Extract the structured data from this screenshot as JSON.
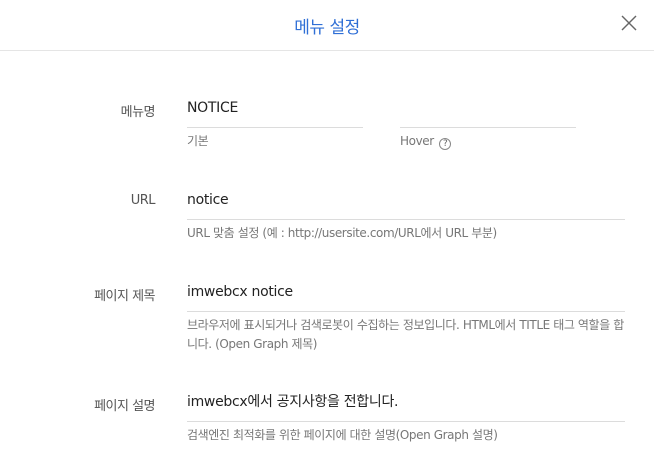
{
  "header": {
    "title": "메뉴 설정",
    "close_icon": "close-icon"
  },
  "fields": {
    "menu_name": {
      "label": "메뉴명",
      "value": "NOTICE",
      "default_label": "기본",
      "hover_label": "Hover",
      "hover_value": "",
      "help_icon": "question-circle-icon",
      "help_glyph": "?"
    },
    "url": {
      "label": "URL",
      "value": "notice",
      "helper": "URL 맞춤 설정 (예 : http://usersite.com/URL에서 URL 부분)"
    },
    "page_title": {
      "label": "페이지 제목",
      "value": "imwebcx notice",
      "helper": "브라우저에 표시되거나 검색로봇이 수집하는 정보입니다. HTML에서 TITLE 태그 역할을 합니다. (Open Graph 제목)"
    },
    "page_description": {
      "label": "페이지 설명",
      "value": "imwebcx에서 공지사항을 전합니다.",
      "helper": "검색엔진 최적화를 위한 페이지에 대한 설명(Open Graph 설명)"
    }
  },
  "colors": {
    "title": "#2f6fd6",
    "border": "#dcdcdc",
    "helper_text": "#777777"
  }
}
